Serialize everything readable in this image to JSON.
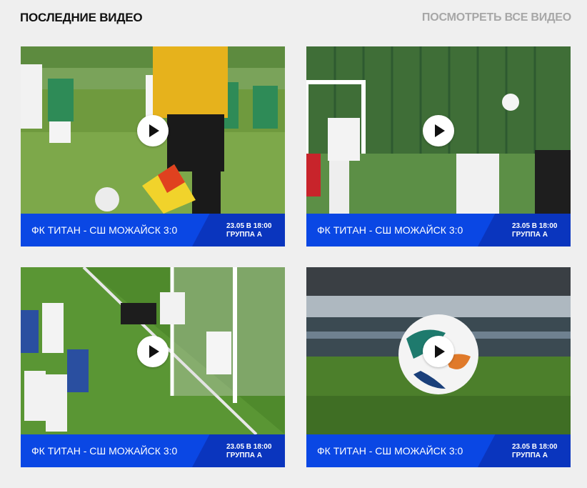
{
  "header": {
    "title": "ПОСЛЕДНИЕ ВИДЕО",
    "see_all": "ПОСМОТРЕТЬ ВСЕ ВИДЕО"
  },
  "videos": [
    {
      "match": "ФК ТИТАН - СШ МОЖАЙСК 3:0",
      "date": "23.05 В 18:00",
      "group": "ГРУППА А",
      "thumbnail": "women-soccer-referee-flag"
    },
    {
      "match": "ФК ТИТАН - СШ МОЖАЙСК 3:0",
      "date": "23.05 В 18:00",
      "group": "ГРУППА А",
      "thumbnail": "players-kicking-ball-goalkeeper-jump"
    },
    {
      "match": "ФК ТИТАН - СШ МОЖАЙСК 3:0",
      "date": "23.05 В 18:00",
      "group": "ГРУППА А",
      "thumbnail": "goalkeeper-diving-goal-mouth"
    },
    {
      "match": "ФК ТИТАН - СШ МОЖАЙСК 3:0",
      "date": "23.05 В 18:00",
      "group": "ГРУППА А",
      "thumbnail": "ball-on-grass-stadium"
    }
  ],
  "colors": {
    "caption_blue": "#0a47e4",
    "caption_dark": "#0a35be",
    "background": "#efefef"
  }
}
